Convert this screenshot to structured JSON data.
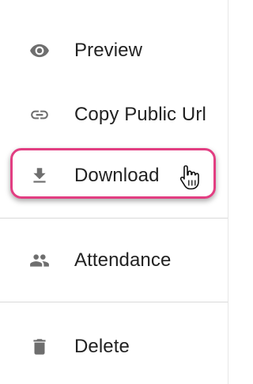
{
  "menu": {
    "items": [
      {
        "label": "Preview",
        "icon": "eye-icon"
      },
      {
        "label": "Copy Public Url",
        "icon": "link-icon"
      },
      {
        "label": "Download",
        "icon": "download-icon"
      },
      {
        "label": "Attendance",
        "icon": "people-icon"
      },
      {
        "label": "Delete",
        "icon": "trash-icon"
      }
    ],
    "highlighted_item": "Download"
  },
  "colors": {
    "highlight_border": "#e23e82",
    "icon": "#6e6e6e",
    "text": "#222222",
    "divider": "#d9d9d9"
  },
  "cursor": {
    "icon": "hand-pointer-icon"
  }
}
